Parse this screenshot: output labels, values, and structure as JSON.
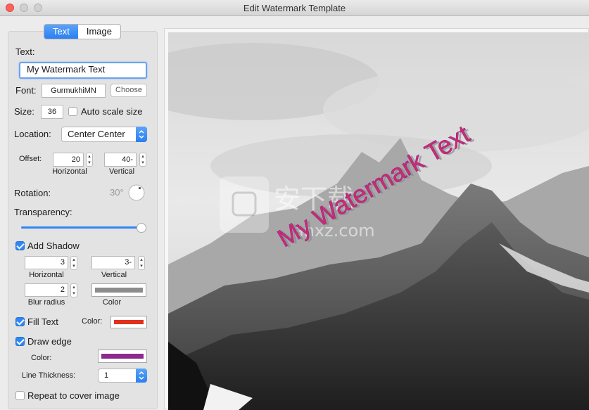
{
  "window": {
    "title": "Edit Watermark Template"
  },
  "tabs": {
    "text": "Text",
    "image": "Image",
    "active": "Text"
  },
  "text_section": {
    "label": "Text:",
    "value": "My Watermark Text"
  },
  "font": {
    "label": "Font:",
    "value": "GurmukhiMN",
    "choose": "Choose"
  },
  "size": {
    "label": "Size:",
    "value": "36",
    "auto_label": "Auto scale size",
    "auto_checked": false
  },
  "location": {
    "label": "Location:",
    "value": "Center Center"
  },
  "offset": {
    "label": "Offset:",
    "h_value": "20",
    "v_value": "40-",
    "h_caption": "Horizontal",
    "v_caption": "Vertical"
  },
  "rotation": {
    "label": "Rotation:",
    "value": "30°"
  },
  "transparency": {
    "label": "Transparency:",
    "fraction": 1.0
  },
  "shadow": {
    "label": "Add Shadow",
    "checked": true,
    "h_value": "3",
    "v_value": "3-",
    "h_caption": "Horizontal",
    "v_caption": "Vertical",
    "blur_value": "2",
    "blur_caption": "Blur radius",
    "color_caption": "Color",
    "color": "#8c8c8c"
  },
  "fill": {
    "label": "Fill Text",
    "checked": true,
    "color_label": "Color:",
    "color": "#e0301e"
  },
  "edge": {
    "label": "Draw edge",
    "checked": true,
    "color_label": "Color:",
    "color": "#8e2a8e",
    "thickness_label": "Line Thickness:",
    "thickness_value": "1"
  },
  "repeat": {
    "label": "Repeat to cover image",
    "checked": false
  },
  "preview": {
    "watermark_text": "My Watermark Text",
    "watermark_color": "#cf2a6e",
    "site_text": "安下载",
    "site_url": "anxz.com"
  },
  "colors": {
    "accent": "#2f86f3",
    "panel": "#e3e3e3"
  },
  "icons": {
    "rotation_knob": "rotation-knob-icon",
    "stepper": "stepper-arrows-icon",
    "popup": "popup-chevrons-icon"
  }
}
